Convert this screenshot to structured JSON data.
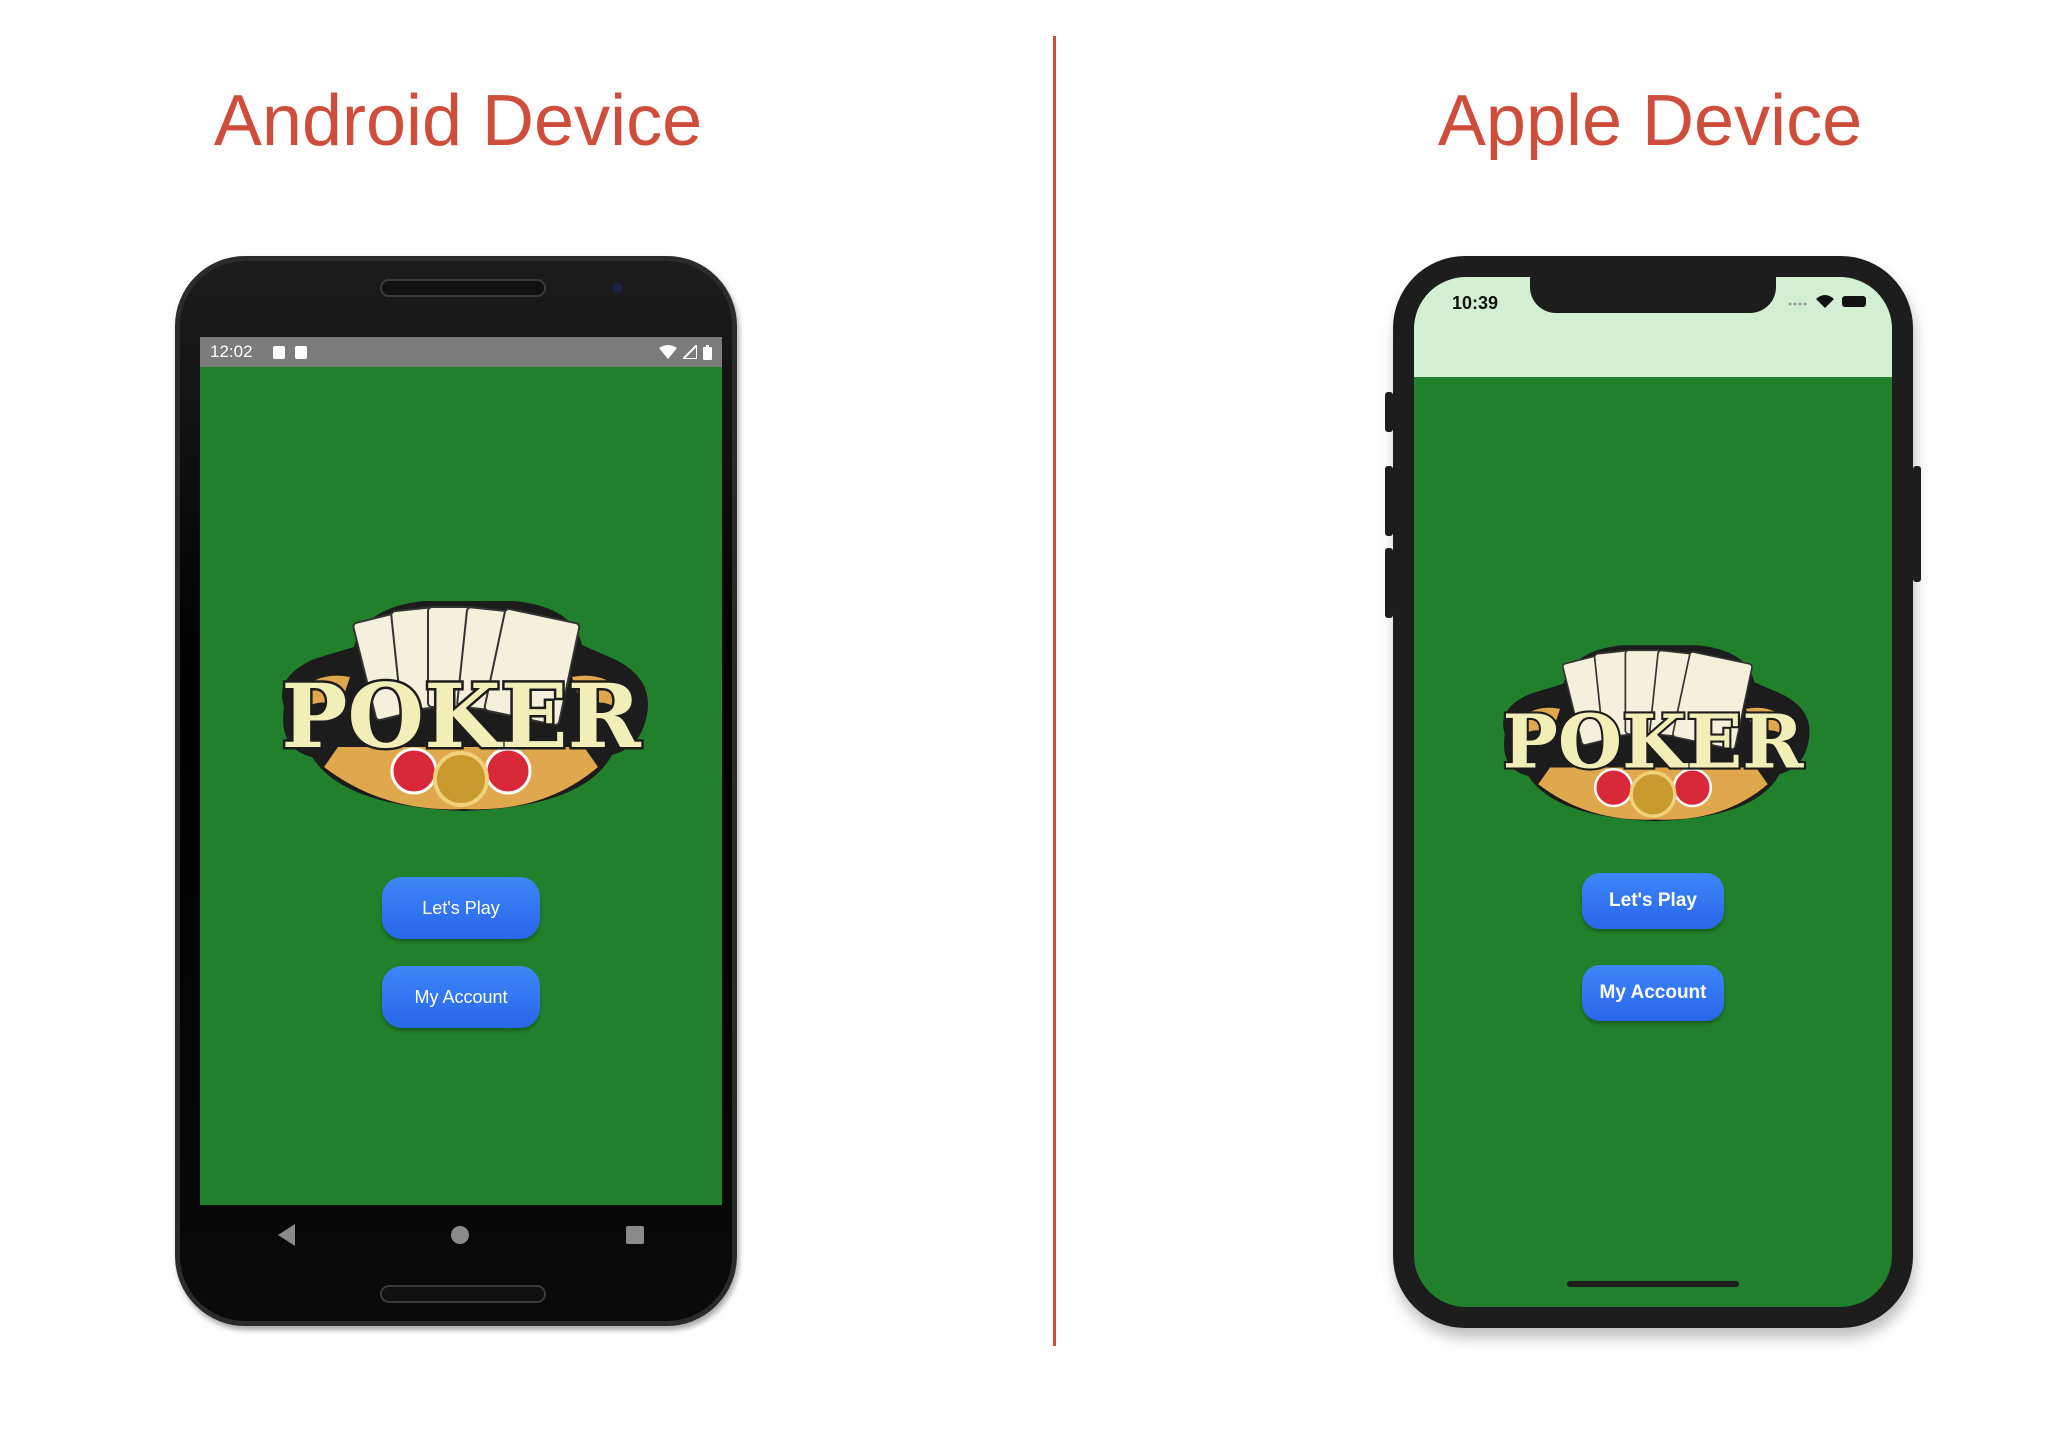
{
  "headings": {
    "android": "Android Device",
    "apple": "Apple Device"
  },
  "android": {
    "status_time": "12:02",
    "logo_text": "POKER",
    "buttons": {
      "play": "Let's Play",
      "account": "My Account"
    }
  },
  "apple": {
    "status_time": "10:39",
    "logo_text": "POKER",
    "buttons": {
      "play": "Let's Play",
      "account": "My Account"
    }
  },
  "colors": {
    "heading": "#cf4e3b",
    "table_green": "#21802b",
    "button_blue": "#3079f2",
    "ios_header": "#d3efd3"
  }
}
